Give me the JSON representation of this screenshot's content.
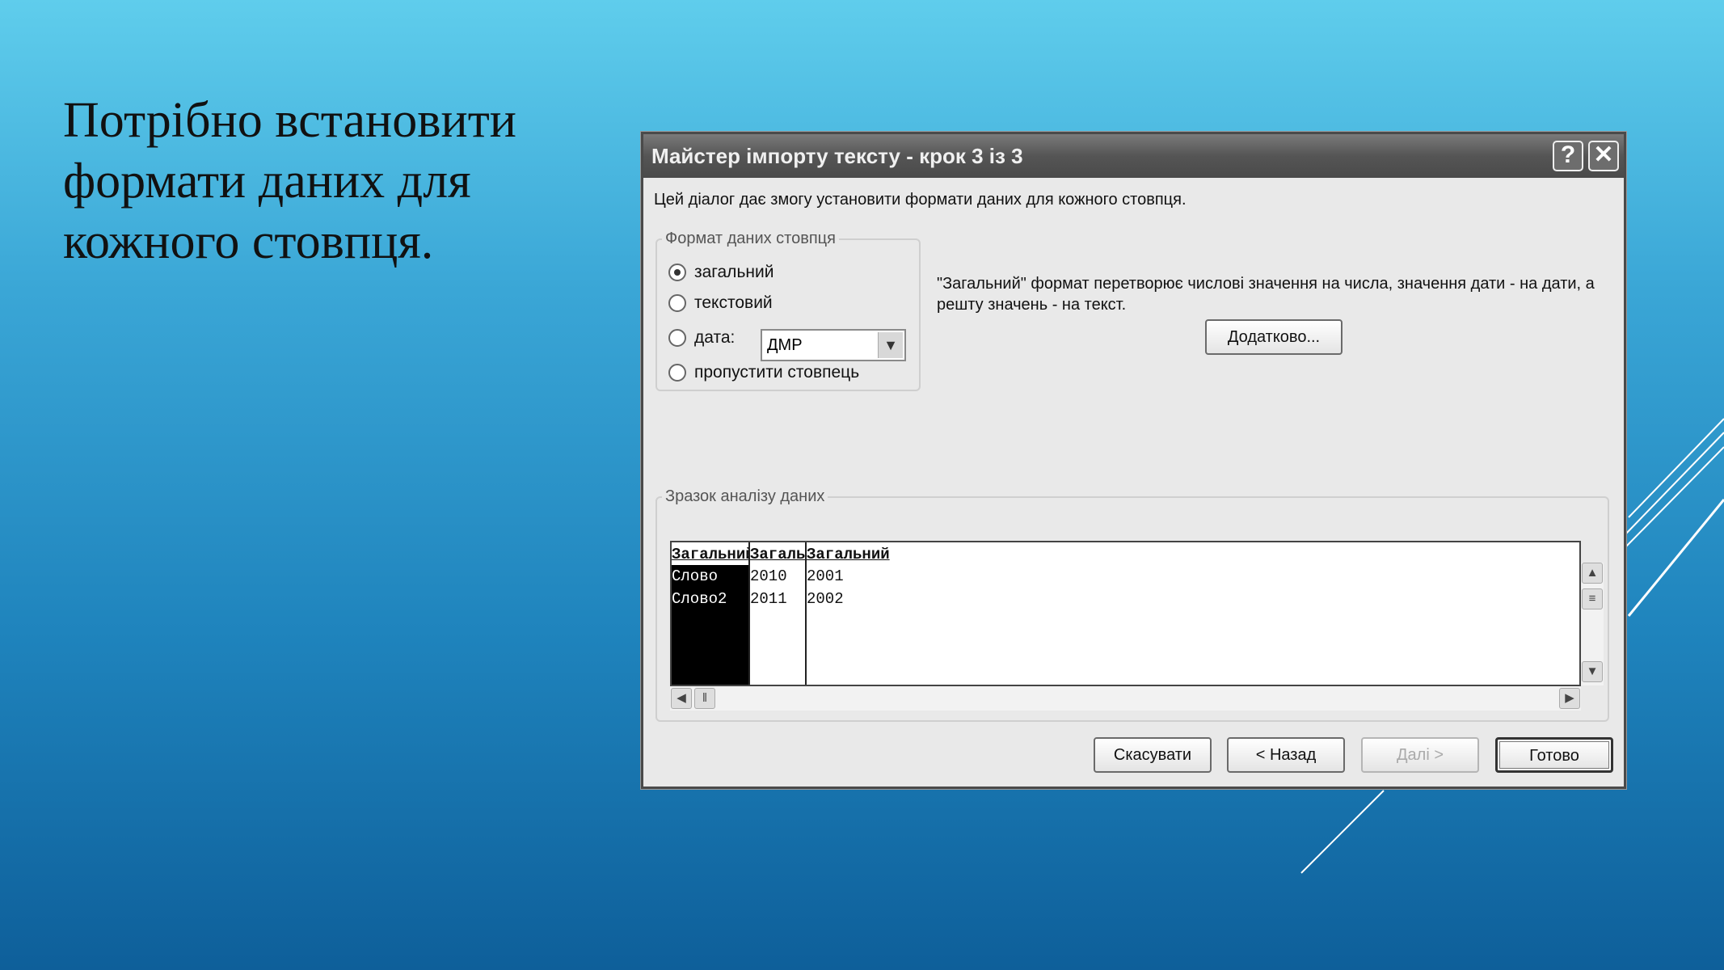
{
  "slide": {
    "text_lines": [
      "Потрібно встановити",
      "формати даних для",
      "кожного стовпця."
    ]
  },
  "dialog": {
    "title": "Майстер імпорту тексту - крок 3 із 3",
    "help_label": "?",
    "close_label": "✕",
    "description": "Цей діалог дає змогу установити формати даних для кожного стовпця.",
    "format_group": {
      "legend": "Формат даних стовпця",
      "options": [
        "загальний",
        "текстовий",
        "дата:",
        "пропустити стовпець"
      ],
      "selected": "загальний",
      "date_format_value": "ДМР"
    },
    "info_text": "\"Загальний\" формат перетворює числові значення на числа, значення дати - на дати, а решту значень - на текст.",
    "advanced_button": "Додатково...",
    "preview_group": {
      "legend": "Зразок аналізу даних",
      "headers": [
        "Загальний",
        "Загальний",
        "Загальний"
      ],
      "rows": [
        [
          "Слово",
          "2010",
          "2001"
        ],
        [
          "Слово2",
          "2011",
          "2002"
        ]
      ]
    },
    "buttons": {
      "cancel": "Скасувати",
      "back": "< Назад",
      "next": "Далі >",
      "finish": "Готово"
    }
  }
}
